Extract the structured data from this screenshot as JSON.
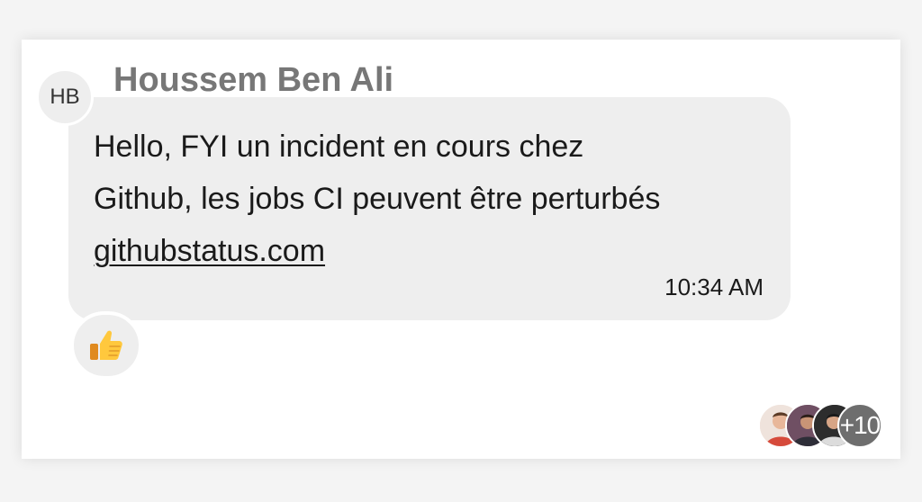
{
  "message": {
    "avatar_initials": "HB",
    "sender_name": "Houssem Ben Ali",
    "lines": [
      "Hello, FYI un incident en cours chez",
      "Github, les jobs CI peuvent être perturbés"
    ],
    "link_text": "githubstatus.com",
    "time": "10:34 AM"
  },
  "reaction": {
    "icon": "thumbs-up-icon"
  },
  "read_receipts": {
    "avatars": [
      "reader-avatar",
      "reader-avatar",
      "reader-avatar"
    ],
    "more_count": "+10"
  },
  "colors": {
    "bubble": "#eeeeee",
    "sender": "#777777",
    "more_badge": "#6e6e6e"
  }
}
